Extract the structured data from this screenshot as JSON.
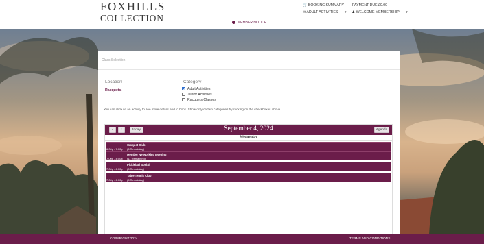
{
  "header": {
    "logo_line1": "FOXHILLS",
    "logo_line2": "COLLECTION",
    "booking_summary": "BOOKING SUMMARY",
    "payment_due": "PAYMENT DUE £0.00",
    "adult_activities": "ADULT ACTIVITIES",
    "welcome": "WELCOME MEMBERSHIP",
    "member_notice": "MEMBER NOTICE"
  },
  "panel": {
    "breadcrumb": "Class Selection",
    "location_label": "Location",
    "location_value": "Racquets",
    "category_label": "Category",
    "categories": [
      {
        "label": "Adult Activities",
        "checked": true
      },
      {
        "label": "Junior Activities",
        "checked": false
      },
      {
        "label": "Racquets Classes",
        "checked": false
      }
    ],
    "help_text": "You can click on an activity to see more details and to book. Show only certain categories by clicking on the checkboxes above."
  },
  "calendar": {
    "prev_label": "‹",
    "next_label": "›",
    "today_label": "today",
    "title": "September 4, 2024",
    "agenda_label": "Agenda",
    "day_header": "Wednesday",
    "events": [
      {
        "name": "Croquet Club",
        "time": "6:00p - 7:00p",
        "remaining": "(6 Remaining)"
      },
      {
        "name": "Member Networking Evening",
        "time": "7:00p - 8:00p",
        "remaining": "(11 Remaining)"
      },
      {
        "name": "Pickleball Social",
        "time": "7:00p - 8:00p",
        "remaining": "(5 Remaining)"
      },
      {
        "name": "Table Tennis Club",
        "time": "7:00p - 8:00p",
        "remaining": "(5 Remaining)"
      }
    ]
  },
  "footer": {
    "copyright": "COPYRIGHT 2024",
    "terms": "TERMS AND CONDITIONS"
  },
  "colors": {
    "brand": "#6b1d4a"
  }
}
